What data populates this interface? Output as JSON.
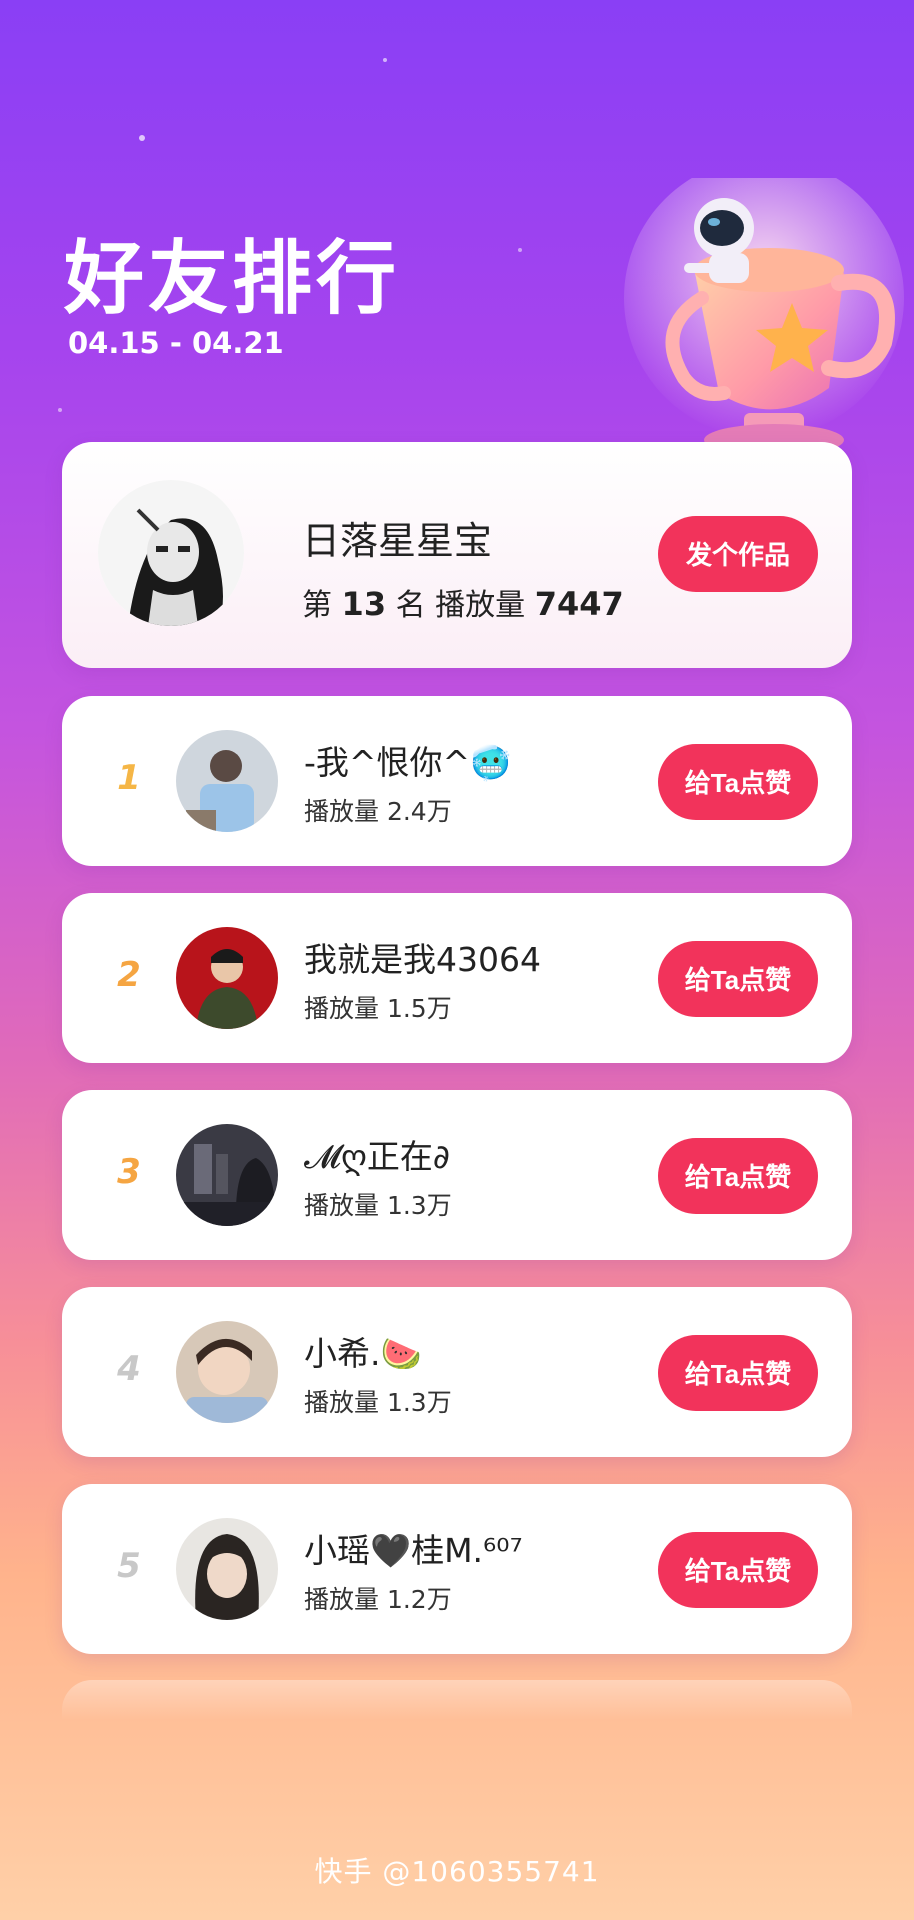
{
  "header": {
    "title": "好友排行",
    "date_range": "04.15 - 04.21"
  },
  "me": {
    "name": "日落星星宝",
    "rank_prefix": "第",
    "rank": "13",
    "rank_suffix": "名",
    "plays_label": "播放量",
    "plays": "7447",
    "button_label": "发个作品"
  },
  "ranking": [
    {
      "rank": "1",
      "name": "-我^恨你^🥶",
      "plays": "播放量 2.4万",
      "button_label": "给Ta点赞",
      "rank_color": "#f5b646"
    },
    {
      "rank": "2",
      "name": "我就是我43064",
      "plays": "播放量 1.5万",
      "button_label": "给Ta点赞",
      "rank_color": "#f5a542"
    },
    {
      "rank": "3",
      "name": "𝓜ღ正在∂",
      "plays": "播放量 1.3万",
      "button_label": "给Ta点赞",
      "rank_color": "#f5a542"
    },
    {
      "rank": "4",
      "name": "小希.🍉",
      "plays": "播放量 1.3万",
      "button_label": "给Ta点赞",
      "rank_color": "#c8c8c8"
    },
    {
      "rank": "5",
      "name": "小瑶🖤桂M.⁶⁰⁷",
      "plays": "播放量 1.2万",
      "button_label": "给Ta点赞",
      "rank_color": "#c8c8c8"
    }
  ],
  "watermark": "快手 @1060355741",
  "colors": {
    "accent_button": "#f2335b",
    "bg_top": "#8a3ff5",
    "bg_bottom": "#ffd0a8"
  }
}
